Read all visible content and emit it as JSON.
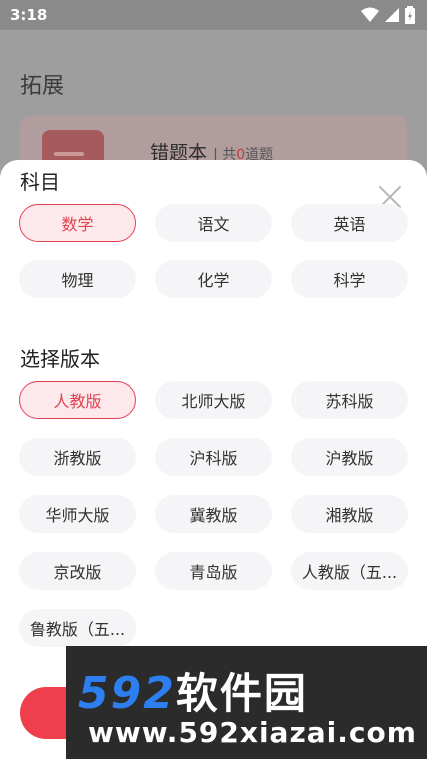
{
  "status_bar": {
    "time": "3:18"
  },
  "background": {
    "title": "拓展",
    "card": {
      "title": "错题本",
      "count_prefix": "| 共",
      "count": "0",
      "count_suffix": "道题"
    }
  },
  "sheet": {
    "subject_section": {
      "title": "科目",
      "options": [
        {
          "label": "数学",
          "selected": true
        },
        {
          "label": "语文",
          "selected": false
        },
        {
          "label": "英语",
          "selected": false
        },
        {
          "label": "物理",
          "selected": false
        },
        {
          "label": "化学",
          "selected": false
        },
        {
          "label": "科学",
          "selected": false
        }
      ]
    },
    "edition_section": {
      "title": "选择版本",
      "options": [
        {
          "label": "人教版",
          "selected": true
        },
        {
          "label": "北师大版",
          "selected": false
        },
        {
          "label": "苏科版",
          "selected": false
        },
        {
          "label": "浙教版",
          "selected": false
        },
        {
          "label": "沪科版",
          "selected": false
        },
        {
          "label": "沪教版",
          "selected": false
        },
        {
          "label": "华师大版",
          "selected": false
        },
        {
          "label": "冀教版",
          "selected": false
        },
        {
          "label": "湘教版",
          "selected": false
        },
        {
          "label": "京改版",
          "selected": false
        },
        {
          "label": "青岛版",
          "selected": false
        },
        {
          "label": "人教版（五...",
          "selected": false
        },
        {
          "label": "鲁教版（五...",
          "selected": false
        }
      ]
    }
  },
  "watermark": {
    "brand_digits": "592",
    "brand_cn": "软件园",
    "url": "www.592xiazai.com"
  },
  "colors": {
    "accent": "#e24352",
    "confirm": "#ef3e4c",
    "chip_bg": "#f5f5f7"
  }
}
